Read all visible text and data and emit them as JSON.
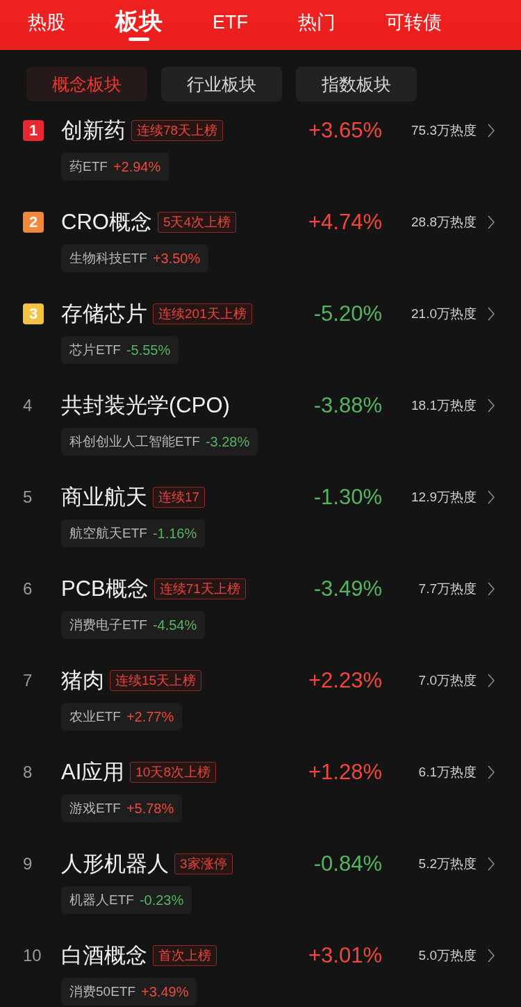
{
  "header_tabs": [
    {
      "label": "热股",
      "selected": false
    },
    {
      "label": "板块",
      "selected": true
    },
    {
      "label": "ETF",
      "selected": false
    },
    {
      "label": "热门",
      "selected": false
    },
    {
      "label": "可转债",
      "selected": false
    }
  ],
  "sub_tabs": [
    {
      "label": "概念板块",
      "selected": true
    },
    {
      "label": "行业板块",
      "selected": false
    },
    {
      "label": "指数板块",
      "selected": false
    }
  ],
  "sectors": [
    {
      "rank": "1",
      "kind": "badge",
      "color": "#e8282e",
      "name": "创新药",
      "tag": "连续78天上榜",
      "change": "+3.65%",
      "rising": true,
      "heat": "75.3万热度",
      "etf": {
        "name": "药ETF",
        "change": "+2.94%",
        "rising": true
      }
    },
    {
      "rank": "2",
      "kind": "badge",
      "color": "#f4883a",
      "name": "CRO概念",
      "tag": "5天4次上榜",
      "change": "+4.74%",
      "rising": true,
      "heat": "28.8万热度",
      "etf": {
        "name": "生物科技ETF",
        "change": "+3.50%",
        "rising": true
      }
    },
    {
      "rank": "3",
      "kind": "badge",
      "color": "#f5c343",
      "name": "存储芯片",
      "tag": "连续201天上榜",
      "change": "-5.20%",
      "rising": false,
      "heat": "21.0万热度",
      "etf": {
        "name": "芯片ETF",
        "change": "-5.55%",
        "rising": false
      }
    },
    {
      "rank": "4",
      "kind": "plain",
      "name": "共封装光学(CPO)",
      "change": "-3.88%",
      "rising": false,
      "heat": "18.1万热度",
      "etf": {
        "name": "科创创业人工智能ETF",
        "change": "-3.28%",
        "rising": false
      }
    },
    {
      "rank": "5",
      "kind": "plain",
      "name": "商业航天",
      "tag": "连续17",
      "change": "-1.30%",
      "rising": false,
      "heat": "12.9万热度",
      "etf": {
        "name": "航空航天ETF",
        "change": "-1.16%",
        "rising": false
      }
    },
    {
      "rank": "6",
      "kind": "plain",
      "name": "PCB概念",
      "tag": "连续71天上榜",
      "change": "-3.49%",
      "rising": false,
      "heat": "7.7万热度",
      "etf": {
        "name": "消费电子ETF",
        "change": "-4.54%",
        "rising": false
      }
    },
    {
      "rank": "7",
      "kind": "plain",
      "name": "猪肉",
      "tag": "连续15天上榜",
      "change": "+2.23%",
      "rising": true,
      "heat": "7.0万热度",
      "etf": {
        "name": "农业ETF",
        "change": "+2.77%",
        "rising": true
      }
    },
    {
      "rank": "8",
      "kind": "plain",
      "name": "AI应用",
      "tag": "10天8次上榜",
      "change": "+1.28%",
      "rising": true,
      "heat": "6.1万热度",
      "etf": {
        "name": "游戏ETF",
        "change": "+5.78%",
        "rising": true
      }
    },
    {
      "rank": "9",
      "kind": "plain",
      "name": "人形机器人",
      "tag": "3家涨停",
      "change": "-0.84%",
      "rising": false,
      "heat": "5.2万热度",
      "etf": {
        "name": "机器人ETF",
        "change": "-0.23%",
        "rising": false
      }
    },
    {
      "rank": "10",
      "kind": "plain",
      "name": "白酒概念",
      "tag": "首次上榜",
      "change": "+3.01%",
      "rising": true,
      "heat": "5.0万热度",
      "etf": {
        "name": "消费50ETF",
        "change": "+3.49%",
        "rising": true
      }
    }
  ]
}
